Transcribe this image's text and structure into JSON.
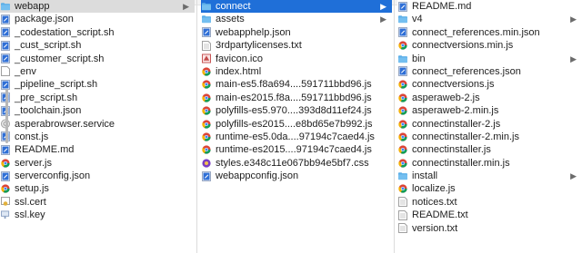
{
  "col1": {
    "items": [
      {
        "name": "webapp",
        "type": "folder",
        "chevron": true,
        "selected": "gray"
      },
      {
        "name": "package.json",
        "type": "json"
      },
      {
        "name": "_codestation_script.sh",
        "type": "sh"
      },
      {
        "name": "_cust_script.sh",
        "type": "sh"
      },
      {
        "name": "_customer_script.sh",
        "type": "sh"
      },
      {
        "name": "_env",
        "type": "blank"
      },
      {
        "name": "_pipeline_script.sh",
        "type": "sh"
      },
      {
        "name": "_pre_script.sh",
        "type": "sh"
      },
      {
        "name": "_toolchain.json",
        "type": "json"
      },
      {
        "name": "asperabrowser.service",
        "type": "gear"
      },
      {
        "name": "const.js",
        "type": "js"
      },
      {
        "name": "README.md",
        "type": "md"
      },
      {
        "name": "server.js",
        "type": "chrome"
      },
      {
        "name": "serverconfig.json",
        "type": "json"
      },
      {
        "name": "setup.js",
        "type": "chrome"
      },
      {
        "name": "ssl.cert",
        "type": "cert"
      },
      {
        "name": "ssl.key",
        "type": "key"
      }
    ]
  },
  "col2": {
    "items": [
      {
        "name": "connect",
        "type": "folder",
        "chevron": true,
        "selected": "blue"
      },
      {
        "name": "assets",
        "type": "folder",
        "chevron": true
      },
      {
        "name": "webapphelp.json",
        "type": "json"
      },
      {
        "name": "3rdpartylicenses.txt",
        "type": "txt"
      },
      {
        "name": "favicon.ico",
        "type": "ico"
      },
      {
        "name": "index.html",
        "type": "chrome"
      },
      {
        "name": "main-es5.f8a694....591711bbd96.js",
        "type": "chrome"
      },
      {
        "name": "main-es2015.f8a....591711bbd96.js",
        "type": "chrome"
      },
      {
        "name": "polyfills-es5.970....393d8d11ef24.js",
        "type": "chrome"
      },
      {
        "name": "polyfills-es2015....e8bd65e7b992.js",
        "type": "chrome"
      },
      {
        "name": "runtime-es5.0da....97194c7caed4.js",
        "type": "chrome"
      },
      {
        "name": "runtime-es2015....97194c7caed4.js",
        "type": "chrome"
      },
      {
        "name": "styles.e348c11e067bb94e5bf7.css",
        "type": "css"
      },
      {
        "name": "webappconfig.json",
        "type": "json"
      }
    ]
  },
  "col3": {
    "items": [
      {
        "name": "README.md",
        "type": "md"
      },
      {
        "name": "v4",
        "type": "folder",
        "chevron": true
      },
      {
        "name": "connect_references.min.json",
        "type": "json"
      },
      {
        "name": "connectversions.min.js",
        "type": "chrome"
      },
      {
        "name": "bin",
        "type": "folder",
        "chevron": true
      },
      {
        "name": "connect_references.json",
        "type": "json"
      },
      {
        "name": "connectversions.js",
        "type": "chrome"
      },
      {
        "name": "asperaweb-2.js",
        "type": "chrome"
      },
      {
        "name": "asperaweb-2.min.js",
        "type": "chrome"
      },
      {
        "name": "connectinstaller-2.js",
        "type": "chrome"
      },
      {
        "name": "connectinstaller-2.min.js",
        "type": "chrome"
      },
      {
        "name": "connectinstaller.js",
        "type": "chrome"
      },
      {
        "name": "connectinstaller.min.js",
        "type": "chrome"
      },
      {
        "name": "install",
        "type": "folder",
        "chevron": true
      },
      {
        "name": "localize.js",
        "type": "chrome"
      },
      {
        "name": "notices.txt",
        "type": "txt"
      },
      {
        "name": "README.txt",
        "type": "txt"
      },
      {
        "name": "version.txt",
        "type": "txt"
      }
    ]
  },
  "colors": {
    "selection_blue": "#1f6fd8",
    "selection_gray": "#dcdcdc",
    "folder": "#5aaee8"
  }
}
